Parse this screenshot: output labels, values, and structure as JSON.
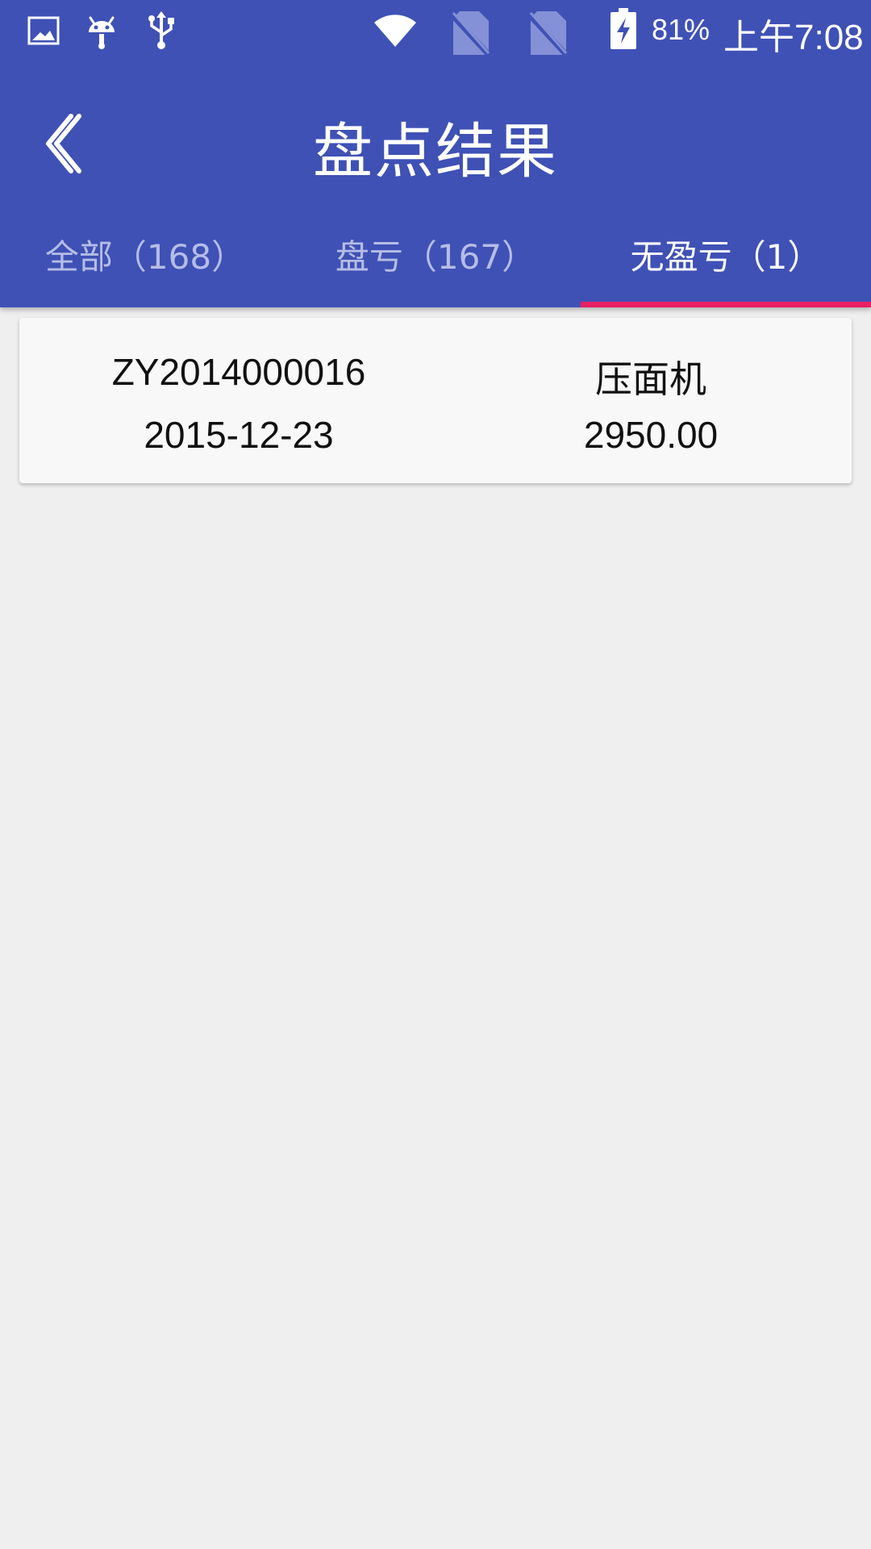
{
  "status_bar": {
    "battery_percent": "81%",
    "time": "上午7:08",
    "icons": [
      "image-icon",
      "android-icon",
      "usb-icon",
      "wifi-icon",
      "no-sim-icon",
      "no-sim-icon",
      "battery-charging-icon"
    ]
  },
  "toolbar": {
    "title": "盘点结果",
    "back_icon": "chevron-left-icon"
  },
  "tabs": [
    {
      "label": "全部（168）",
      "active": false
    },
    {
      "label": "盘亏（167）",
      "active": false
    },
    {
      "label": "无盈亏（1）",
      "active": true
    }
  ],
  "list": {
    "items": [
      {
        "code": "ZY2014000016",
        "name": "压面机",
        "date": "2015-12-23",
        "amount": "2950.00"
      }
    ]
  },
  "colors": {
    "primary": "#3f51b5",
    "accent": "#e91e63",
    "background": "#efefef",
    "card": "#f8f8f8",
    "inactive_tab_text": "#b6bde6"
  }
}
